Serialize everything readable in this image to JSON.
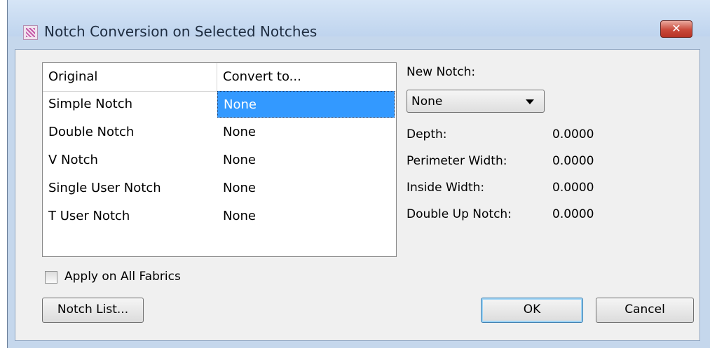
{
  "window": {
    "title": "Notch Conversion on Selected Notches",
    "close_label": "✕"
  },
  "grid": {
    "headers": [
      "Original",
      "Convert to..."
    ],
    "rows": [
      [
        "Simple Notch",
        "None"
      ],
      [
        "Double Notch",
        "None"
      ],
      [
        "V Notch",
        "None"
      ],
      [
        "Single User Notch",
        "None"
      ],
      [
        "T User Notch",
        "None"
      ]
    ]
  },
  "new_notch": {
    "label": "New Notch:",
    "selected": "None"
  },
  "params": [
    {
      "label": "Depth:",
      "value": "0.0000"
    },
    {
      "label": "Perimeter Width:",
      "value": "0.0000"
    },
    {
      "label": "Inside Width:",
      "value": "0.0000"
    },
    {
      "label": "Double Up Notch:",
      "value": "0.0000"
    }
  ],
  "apply_all": {
    "label": "Apply on All Fabrics",
    "checked": false
  },
  "buttons": {
    "notch_list": "Notch List...",
    "ok": "OK",
    "cancel": "Cancel"
  }
}
